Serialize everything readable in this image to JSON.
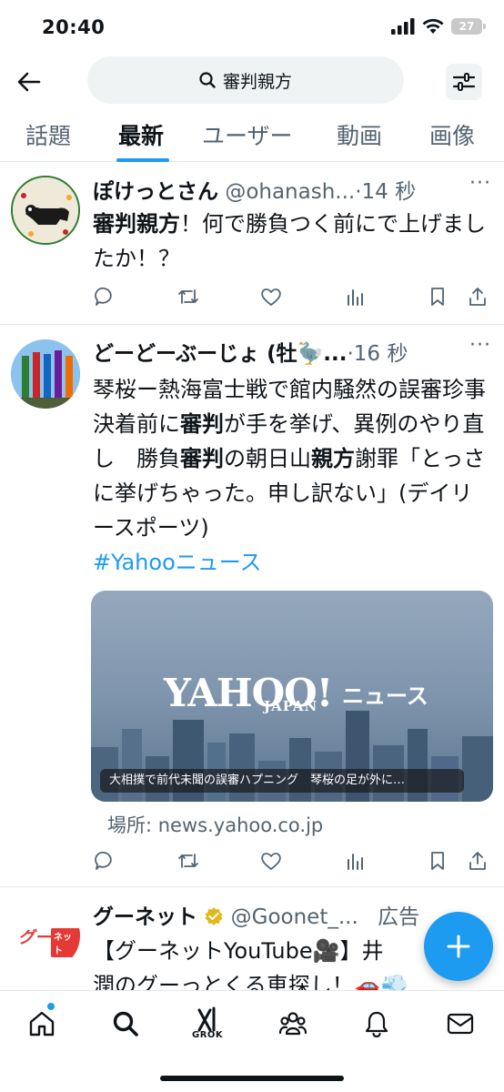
{
  "status": {
    "time": "20:40",
    "battery": "27"
  },
  "search": {
    "query": "審判親方"
  },
  "tabs": [
    {
      "label": "話題"
    },
    {
      "label": "最新"
    },
    {
      "label": "ユーザー"
    },
    {
      "label": "動画"
    },
    {
      "label": "画像"
    }
  ],
  "tweets": [
    {
      "name": "ぽけっとさん",
      "handle": "@ohanash...",
      "sep": "·",
      "time": "14 秒",
      "text_b1": "審判親方",
      "text_1": "！何で勝負つく前にで上げましたか！？"
    },
    {
      "name": "どーどーぶーじょ (牡🦤...",
      "handle": "",
      "sep": "·",
      "time": "16 秒",
      "text_1": "琴桜ー熱海富士戦で館内騒然の誤審珍事　決着前に",
      "text_b1": "審判",
      "text_2": "が手を挙げ、異例のやり直し　勝負",
      "text_b2": "審判",
      "text_3": "の朝日山",
      "text_b3": "親方",
      "text_4": "謝罪「とっさに挙げちゃった。申し訳ない」(デイリースポーツ)",
      "hashtag": "#Yahooニュース",
      "card": {
        "logo": "YAHOO!",
        "logo_sub": "JAPAN",
        "logo_news": "ニュース",
        "caption": "大相撲で前代未聞の誤審ハプニング　琴桜の足が外に…"
      },
      "source": "場所: news.yahoo.co.jp"
    },
    {
      "name": "グーネット",
      "handle": "@Goonet_...",
      "ad": "広告",
      "avatar_text": "グー",
      "avatar_sub": "ネット",
      "text_1": "【グーネットYouTube🎥】井",
      "text_2": "潤のグーっとくる車探し！🚗💨"
    }
  ],
  "nav": {
    "grok": "GROK"
  },
  "colors": {
    "accent": "#1d9bf0",
    "text": "#0f1419",
    "muted": "#536471"
  }
}
